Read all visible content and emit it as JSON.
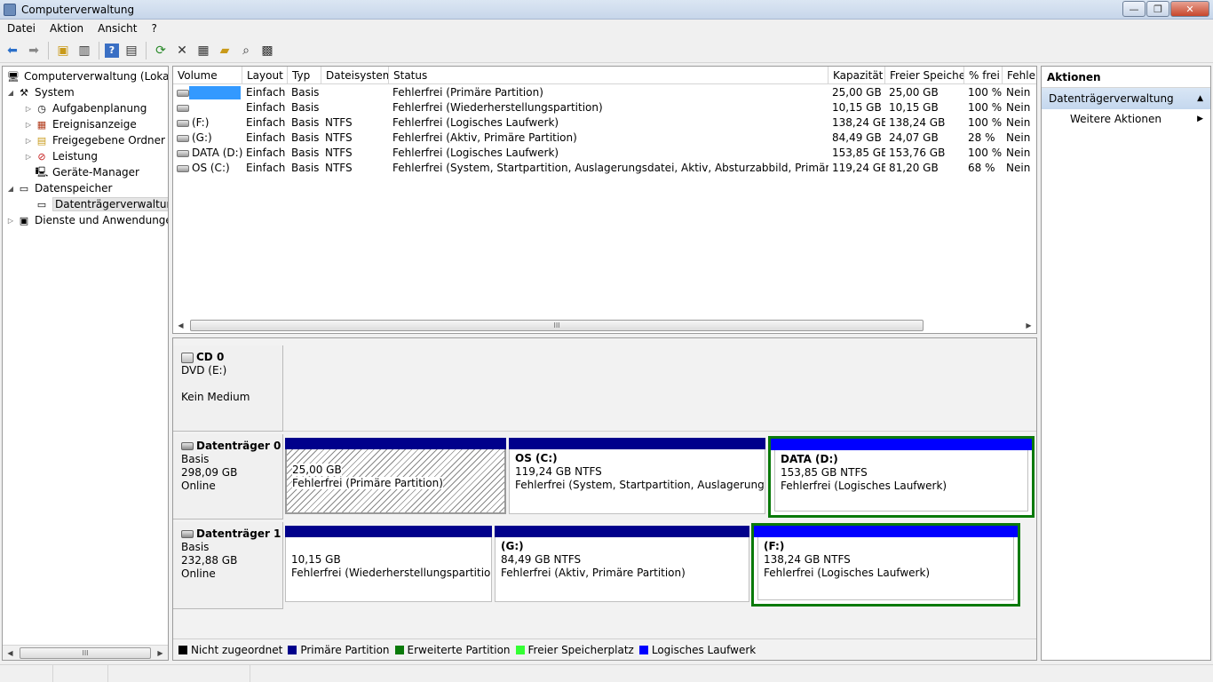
{
  "window": {
    "title": "Computerverwaltung"
  },
  "menu": [
    "Datei",
    "Aktion",
    "Ansicht",
    "?"
  ],
  "toolbar": {
    "icons": [
      "back-icon",
      "forward-icon",
      "folder-up-icon",
      "console-tree-icon",
      "help-icon",
      "action-pane-icon",
      "refresh-icon",
      "delete-icon",
      "properties-icon",
      "open-icon",
      "search-icon",
      "export-icon"
    ]
  },
  "tree": {
    "items": [
      {
        "label": "Computerverwaltung (Lokal)",
        "level": 0,
        "expander": "",
        "icon": "computer-icon"
      },
      {
        "label": "System",
        "level": 1,
        "expander": "▲",
        "icon": "tools-icon"
      },
      {
        "label": "Aufgabenplanung",
        "level": 2,
        "expander": "▷",
        "icon": "clock-icon"
      },
      {
        "label": "Ereignisanzeige",
        "level": 2,
        "expander": "▷",
        "icon": "event-viewer-icon"
      },
      {
        "label": "Freigegebene Ordner",
        "level": 2,
        "expander": "▷",
        "icon": "shared-folder-icon"
      },
      {
        "label": "Leistung",
        "level": 2,
        "expander": "▷",
        "icon": "performance-icon"
      },
      {
        "label": "Geräte-Manager",
        "level": 2,
        "expander": "",
        "icon": "device-manager-icon"
      },
      {
        "label": "Datenspeicher",
        "level": 1,
        "expander": "▲",
        "icon": "storage-icon"
      },
      {
        "label": "Datenträgerverwaltung",
        "level": 2,
        "expander": "",
        "icon": "disk-management-icon"
      },
      {
        "label": "Dienste und Anwendungen",
        "level": 1,
        "expander": "▷",
        "icon": "services-icon"
      }
    ],
    "selected_index": 8
  },
  "volume_list": {
    "columns": [
      "Volume",
      "Layout",
      "Typ",
      "Dateisystem",
      "Status",
      "Kapazität",
      "Freier Speicher",
      "% frei",
      "Fehler"
    ],
    "rows": [
      {
        "volume": "",
        "layout": "Einfach",
        "typ": "Basis",
        "fs": "",
        "status": "Fehlerfrei (Primäre Partition)",
        "cap": "25,00 GB",
        "free": "25,00 GB",
        "pct": "100 %",
        "err": "Nein"
      },
      {
        "volume": "",
        "layout": "Einfach",
        "typ": "Basis",
        "fs": "",
        "status": "Fehlerfrei (Wiederherstellungspartition)",
        "cap": "10,15 GB",
        "free": "10,15 GB",
        "pct": "100 %",
        "err": "Nein"
      },
      {
        "volume": "(F:)",
        "layout": "Einfach",
        "typ": "Basis",
        "fs": "NTFS",
        "status": "Fehlerfrei (Logisches Laufwerk)",
        "cap": "138,24 GB",
        "free": "138,24 GB",
        "pct": "100 %",
        "err": "Nein"
      },
      {
        "volume": "(G:)",
        "layout": "Einfach",
        "typ": "Basis",
        "fs": "NTFS",
        "status": "Fehlerfrei (Aktiv, Primäre Partition)",
        "cap": "84,49 GB",
        "free": "24,07 GB",
        "pct": "28 %",
        "err": "Nein"
      },
      {
        "volume": "DATA (D:)",
        "layout": "Einfach",
        "typ": "Basis",
        "fs": "NTFS",
        "status": "Fehlerfrei (Logisches Laufwerk)",
        "cap": "153,85 GB",
        "free": "153,76 GB",
        "pct": "100 %",
        "err": "Nein"
      },
      {
        "volume": "OS (C:)",
        "layout": "Einfach",
        "typ": "Basis",
        "fs": "NTFS",
        "status": "Fehlerfrei (System, Startpartition, Auslagerungsdatei, Aktiv, Absturzabbild, Primäre Partition)",
        "cap": "119,24 GB",
        "free": "81,20 GB",
        "pct": "68 %",
        "err": "Nein"
      }
    ],
    "scroll_thumb": "III"
  },
  "disks": {
    "cd0": {
      "name": "CD 0",
      "line1": "DVD (E:)",
      "line2": "",
      "line3": "Kein Medium"
    },
    "disk0": {
      "name": "Datenträger 0",
      "type": "Basis",
      "size": "298,09 GB",
      "state": "Online",
      "partitions": [
        {
          "name": "",
          "size": "25,00 GB",
          "status": "Fehlerfrei (Primäre Partition)"
        },
        {
          "name": "OS  (C:)",
          "size": "119,24 GB NTFS",
          "status": "Fehlerfrei (System, Startpartition, Auslagerungsdatei,"
        },
        {
          "name": "DATA  (D:)",
          "size": "153,85 GB NTFS",
          "status": "Fehlerfrei (Logisches Laufwerk)"
        }
      ]
    },
    "disk1": {
      "name": "Datenträger 1",
      "type": "Basis",
      "size": "232,88 GB",
      "state": "Online",
      "partitions": [
        {
          "name": "",
          "size": "10,15 GB",
          "status": "Fehlerfrei (Wiederherstellungspartition)"
        },
        {
          "name": "(G:)",
          "size": "84,49 GB NTFS",
          "status": "Fehlerfrei (Aktiv, Primäre Partition)"
        },
        {
          "name": "(F:)",
          "size": "138,24 GB NTFS",
          "status": "Fehlerfrei (Logisches Laufwerk)"
        }
      ]
    }
  },
  "legend": [
    {
      "label": "Nicht zugeordnet",
      "color": "#000000"
    },
    {
      "label": "Primäre Partition",
      "color": "#00008b"
    },
    {
      "label": "Erweiterte Partition",
      "color": "#0a7a0a"
    },
    {
      "label": "Freier Speicherplatz",
      "color": "#33ff33"
    },
    {
      "label": "Logisches Laufwerk",
      "color": "#0000ff"
    }
  ],
  "actions": {
    "header": "Aktionen",
    "section": "Datenträgerverwaltung",
    "item": "Weitere Aktionen"
  },
  "tree_scroll_thumb": "III"
}
